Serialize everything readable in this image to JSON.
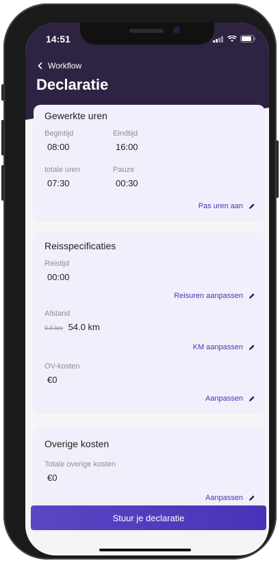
{
  "status": {
    "time": "14:51"
  },
  "nav": {
    "back_label": "Workflow"
  },
  "page": {
    "title": "Declaratie"
  },
  "hours": {
    "title": "Gewerkte uren",
    "start_label": "Begintijd",
    "start_value": "08:00",
    "end_label": "Eindtijd",
    "end_value": "16:00",
    "total_label": "totale uren",
    "total_value": "07:30",
    "pause_label": "Pauze",
    "pause_value": "00:30",
    "action": "Pas uren aan"
  },
  "travel": {
    "title": "Reisspecificaties",
    "time_label": "Reistijd",
    "time_value": "00:00",
    "time_action": "Reisuren aanpassen",
    "distance_label": "Afstand",
    "distance_old": "0.0 km",
    "distance_value": "54.0 km",
    "distance_action": "KM aanpassen",
    "ov_label": "OV-kosten",
    "ov_value": "€0",
    "ov_action": "Aanpassen"
  },
  "other": {
    "title": "Overige kosten",
    "total_label": "Totale overige kosten",
    "total_value": "€0",
    "action": "Aanpassen"
  },
  "submit": {
    "label": "Stuur je declaratie"
  },
  "colors": {
    "header": "#2e2342",
    "accent": "#4a36b0",
    "card": "#f1effb"
  }
}
